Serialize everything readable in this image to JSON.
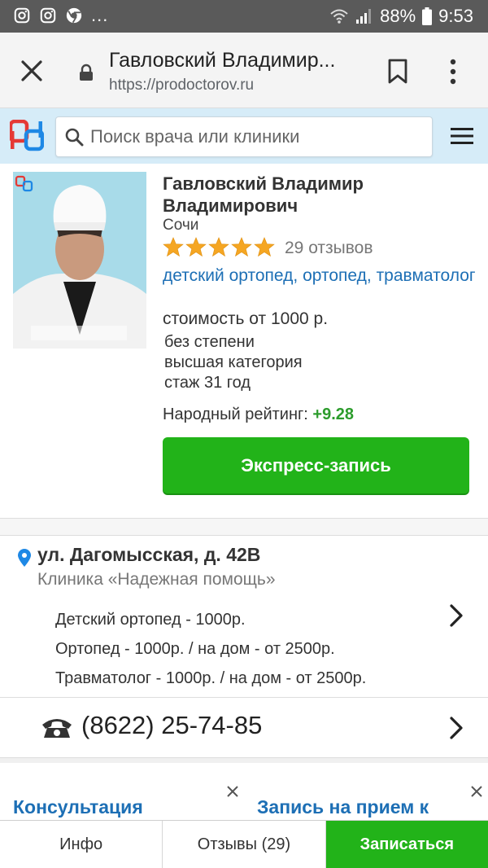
{
  "status_bar": {
    "battery": "88%",
    "time": "9:53",
    "more": "..."
  },
  "browser": {
    "page_title": "Гавловский Владимир...",
    "url": "https://prodoctorov.ru"
  },
  "search": {
    "placeholder": "Поиск врача или клиники"
  },
  "doctor": {
    "name": "Гавловский Владимир Владимирович",
    "city": "Сочи",
    "stars": 5,
    "reviews": "29 отзывов",
    "specialties": [
      "детский ортопед",
      "ортопед",
      "травматолог"
    ],
    "cost": "стоимость от 1000 р.",
    "degree": "без степени",
    "category": "высшая категория",
    "experience": "стаж 31 год",
    "rating_label": "Народный рейтинг:",
    "rating_value": "+9.28",
    "express_button": "Экспресс-запись",
    "photo_watermark": "prodoctorov"
  },
  "clinic": {
    "address": "ул. Дагомысская, д. 42В",
    "name": "Клиника «Надежная помощь»",
    "prices": [
      "Детский ортопед - 1000р.",
      "Ортопед - 1000р. / на дом - от 2500р.",
      "Травматолог - 1000р. / на дом - от 2500р."
    ],
    "phone": "(8622) 25-74-85"
  },
  "promo": {
    "left": "Консультация",
    "right": "Запись на прием к"
  },
  "tabs": {
    "info": "Инфо",
    "reviews": "Отзывы (29)",
    "book": "Записаться"
  },
  "colors": {
    "accent_green": "#22b319",
    "link_blue": "#1d6fb5",
    "header_bg": "#d6ecf8",
    "star": "#f5a623"
  }
}
